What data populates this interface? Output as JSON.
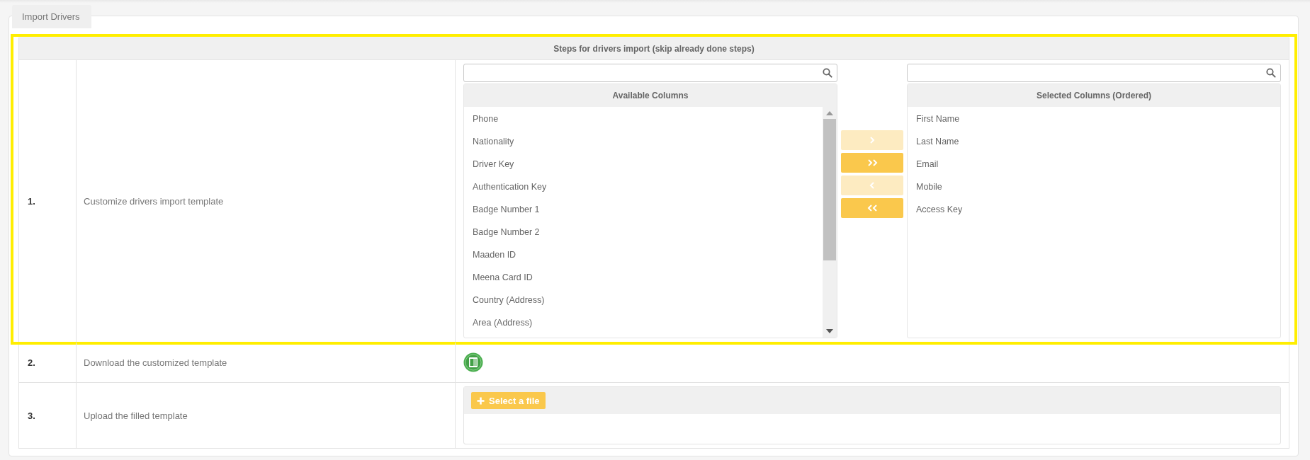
{
  "tab": {
    "label": "Import Drivers"
  },
  "steps_table": {
    "title": "Steps for drivers import (skip already done steps)",
    "rows": [
      {
        "number": "1.",
        "description": "Customize drivers import template",
        "kind": "picker",
        "highlighted": true
      },
      {
        "number": "2.",
        "description": "Download the customized template",
        "kind": "download",
        "highlighted": false
      },
      {
        "number": "3.",
        "description": "Upload the filled template",
        "kind": "upload",
        "highlighted": false,
        "button": "Select a file"
      }
    ]
  },
  "available_columns": {
    "title": "Available Columns",
    "items": [
      "Phone",
      "Nationality",
      "Driver Key",
      "Authentication Key",
      "Badge Number 1",
      "Badge Number 2",
      "Maaden ID",
      "Meena Card ID",
      "Country (Address)",
      "Area (Address)"
    ]
  },
  "transfer_buttons": [
    {
      "kind": "add",
      "disabled": true
    },
    {
      "kind": "add_all",
      "disabled": false
    },
    {
      "kind": "remove",
      "disabled": true
    },
    {
      "kind": "remove_all",
      "disabled": false
    }
  ],
  "selected_columns": {
    "title": "Selected Columns (Ordered)",
    "items": [
      "First Name",
      "Last Name",
      "Email",
      "Mobile",
      "Access Key"
    ]
  }
}
